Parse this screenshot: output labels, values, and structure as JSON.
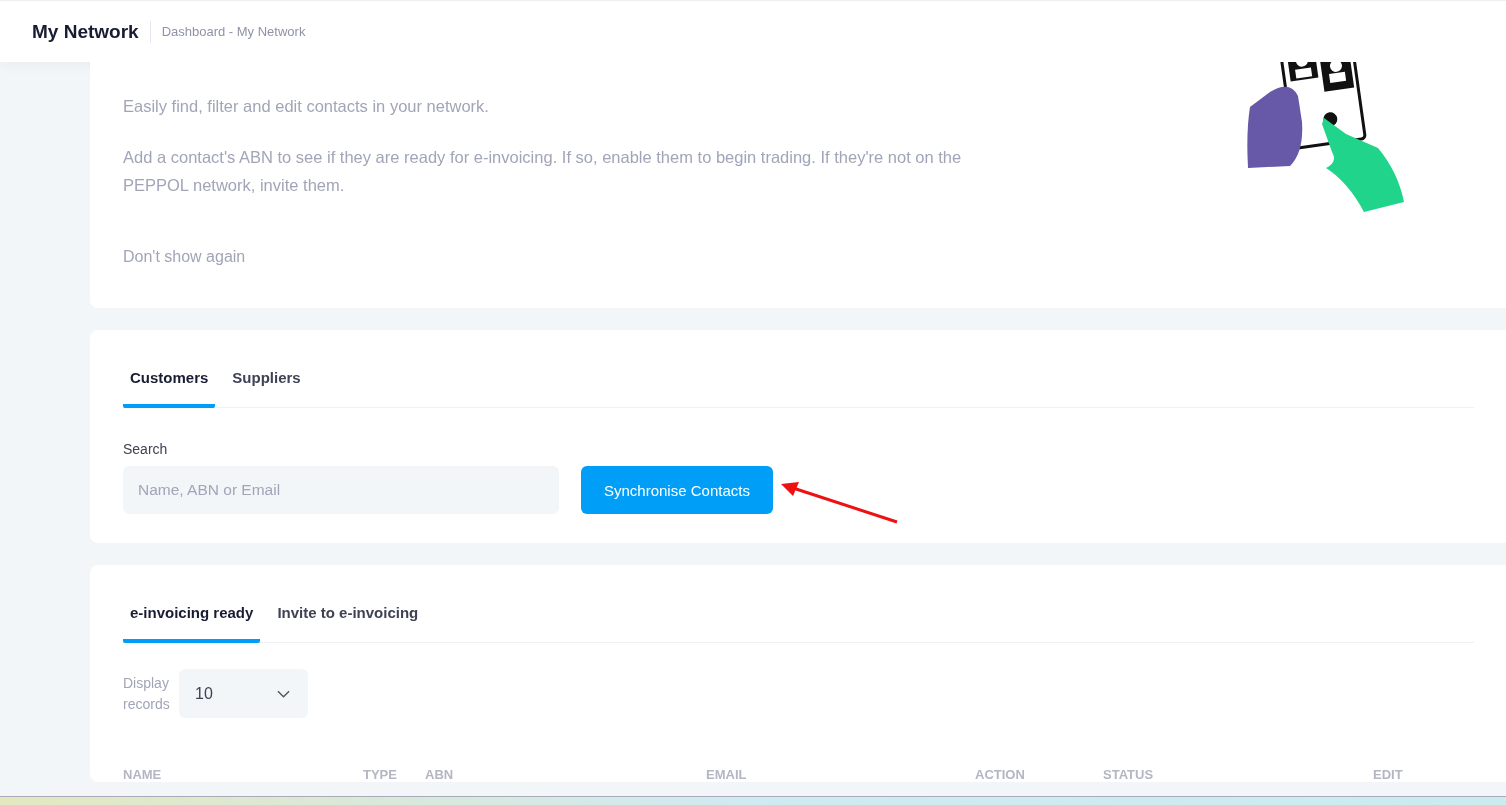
{
  "header": {
    "title": "My Network",
    "breadcrumb": "Dashboard - My Network"
  },
  "intro": {
    "paragraphs": [
      "Easily find, filter and edit contacts in your network.",
      "Add a contact's ABN to see if they are ready for e-invoicing. If so, enable them to begin trading. If they're not on the PEPPOL network, invite them."
    ],
    "dismiss": "Don't show again"
  },
  "contact_tabs": [
    {
      "label": "Customers",
      "selected": true
    },
    {
      "label": "Suppliers",
      "selected": false
    }
  ],
  "search": {
    "label": "Search",
    "placeholder": "Name, ABN or Email"
  },
  "sync_button": "Synchronise Contacts",
  "list_tabs": [
    {
      "label": "e-invoicing ready",
      "selected": true
    },
    {
      "label": "Invite to e-invoicing",
      "selected": false
    }
  ],
  "display_records": {
    "label": "Display records",
    "value": "10"
  },
  "table": {
    "columns": [
      "NAME",
      "TYPE",
      "ABN",
      "EMAIL",
      "ACTION",
      "STATUS",
      "EDIT"
    ]
  }
}
